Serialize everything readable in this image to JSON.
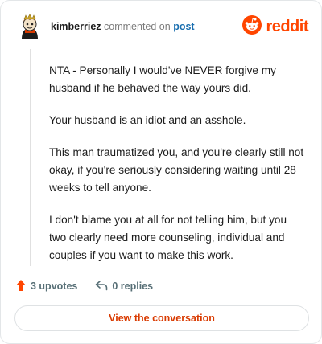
{
  "header": {
    "username": "kimberriez",
    "action_text": "commented on",
    "post_link": "post",
    "brand": "reddit",
    "avatar_icon": "avatar-icon",
    "brand_icon": "reddit-snoo-icon"
  },
  "comment": {
    "paragraphs": [
      "NTA - Personally I would've NEVER forgive my husband if he behaved the way yours did.",
      "Your husband is an idiot and an asshole.",
      "This man traumatized you, and you're clearly still not okay, if you're seriously considering waiting until 28 weeks to tell anyone.",
      "I don't blame you at all for not telling him, but you two clearly need more counseling, individual and couples if you want to make this work."
    ]
  },
  "actions": {
    "upvotes": "3 upvotes",
    "replies": "0 replies",
    "upvote_icon": "upvote-arrow-icon",
    "reply_icon": "reply-arrow-icon"
  },
  "cta": {
    "label": "View the conversation"
  },
  "colors": {
    "brand": "#ff4500",
    "link": "#1a6fb0",
    "muted": "#576f76",
    "cta_text": "#d93a00"
  }
}
